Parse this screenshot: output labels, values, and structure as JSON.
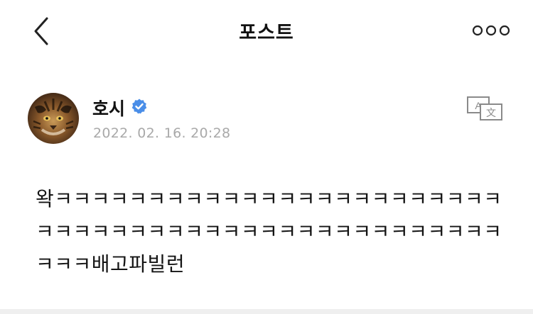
{
  "header": {
    "title": "포스트",
    "back_icon": "chevron-left-icon",
    "more_icon": "more-horizontal-icon"
  },
  "post": {
    "author": "호시",
    "verified_icon": "verified-badge-icon",
    "verified_color": "#4a8ee8",
    "timestamp": "2022. 02. 16. 20:28",
    "translate_icon": "translate-icon",
    "body": "왁ㅋㅋㅋㅋㅋㅋㅋㅋㅋㅋㅋㅋㅋㅋㅋㅋㅋㅋㅋㅋㅋㅋㅋㅋㅋㅋㅋㅋㅋㅋㅋㅋㅋㅋㅋㅋㅋㅋㅋㅋㅋㅋㅋㅋㅋㅋㅋㅋㅋㅋㅋㅋ배고파빌런"
  }
}
